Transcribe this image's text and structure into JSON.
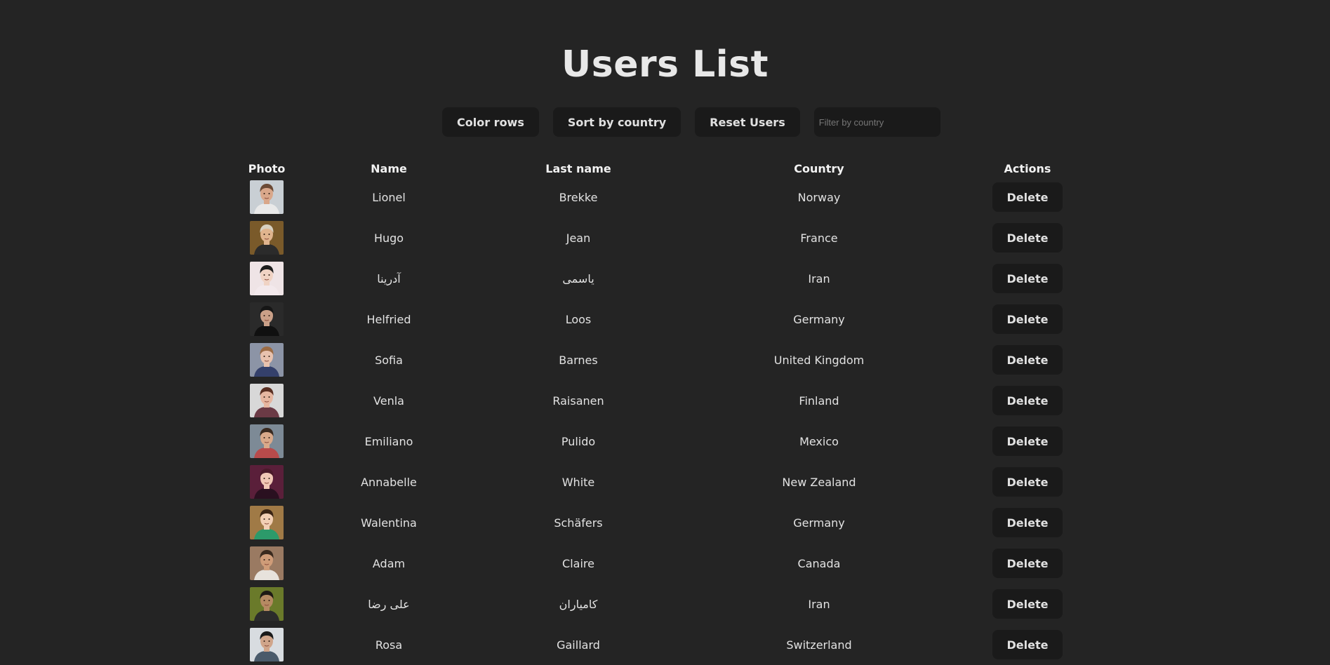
{
  "page": {
    "title": "Users List"
  },
  "toolbar": {
    "color_rows_label": "Color rows",
    "sort_label": "Sort by country",
    "reset_label": "Reset Users",
    "filter_placeholder": "Filter by country",
    "filter_value": ""
  },
  "table": {
    "headers": {
      "photo": "Photo",
      "name": "Name",
      "last_name": "Last name",
      "country": "Country",
      "actions": "Actions"
    },
    "delete_label": "Delete",
    "rows": [
      {
        "name": "Lionel",
        "last": "Brekke",
        "country": "Norway",
        "avatar": {
          "bg": "#c9cfd4",
          "skin": "#d9a78a",
          "hair": "#6b4a35",
          "shirt": "#e9e9e9"
        }
      },
      {
        "name": "Hugo",
        "last": "Jean",
        "country": "France",
        "avatar": {
          "bg": "#7a5a2a",
          "skin": "#e0b48e",
          "hair": "#d7d0c0",
          "shirt": "#2b2b2b"
        }
      },
      {
        "name": "آدرینا",
        "last": "یاسمی",
        "country": "Iran",
        "avatar": {
          "bg": "#efe4e6",
          "skin": "#f0d3c4",
          "hair": "#1d1d1d",
          "shirt": "#f3e9ec"
        }
      },
      {
        "name": "Helfried",
        "last": "Loos",
        "country": "Germany",
        "avatar": {
          "bg": "#2a2a2a",
          "skin": "#caa088",
          "hair": "#161616",
          "shirt": "#101010"
        }
      },
      {
        "name": "Sofia",
        "last": "Barnes",
        "country": "United Kingdom",
        "avatar": {
          "bg": "#8c94a6",
          "skin": "#e8c2ae",
          "hair": "#9b6b45",
          "shirt": "#34406b"
        }
      },
      {
        "name": "Venla",
        "last": "Raisanen",
        "country": "Finland",
        "avatar": {
          "bg": "#d8d8d8",
          "skin": "#e6b6a0",
          "hair": "#5a2f22",
          "shirt": "#6b3a45"
        }
      },
      {
        "name": "Emiliano",
        "last": "Pulido",
        "country": "Mexico",
        "avatar": {
          "bg": "#7d8a96",
          "skin": "#d9a98a",
          "hair": "#3a2a20",
          "shirt": "#b84b4b"
        }
      },
      {
        "name": "Annabelle",
        "last": "White",
        "country": "New Zealand",
        "avatar": {
          "bg": "#5a1f3a",
          "skin": "#f0c8b6",
          "hair": "#4a1a2a",
          "shirt": "#2a1020"
        }
      },
      {
        "name": "Walentina",
        "last": "Schäfers",
        "country": "Germany",
        "avatar": {
          "bg": "#a07a46",
          "skin": "#f2cfb4",
          "hair": "#3a2414",
          "shirt": "#2c9a6a"
        }
      },
      {
        "name": "Adam",
        "last": "Claire",
        "country": "Canada",
        "avatar": {
          "bg": "#9a7a62",
          "skin": "#cf9c78",
          "hair": "#3a2a1e",
          "shirt": "#e7e2dc"
        }
      },
      {
        "name": "علی رضا",
        "last": "کامیاران",
        "country": "Iran",
        "avatar": {
          "bg": "#6a7a2a",
          "skin": "#b58a62",
          "hair": "#1e1a14",
          "shirt": "#2b2b2b"
        }
      },
      {
        "name": "Rosa",
        "last": "Gaillard",
        "country": "Switzerland",
        "avatar": {
          "bg": "#d8dce0",
          "skin": "#d0a58a",
          "hair": "#1a1a1a",
          "shirt": "#4a5a6a"
        }
      }
    ]
  }
}
